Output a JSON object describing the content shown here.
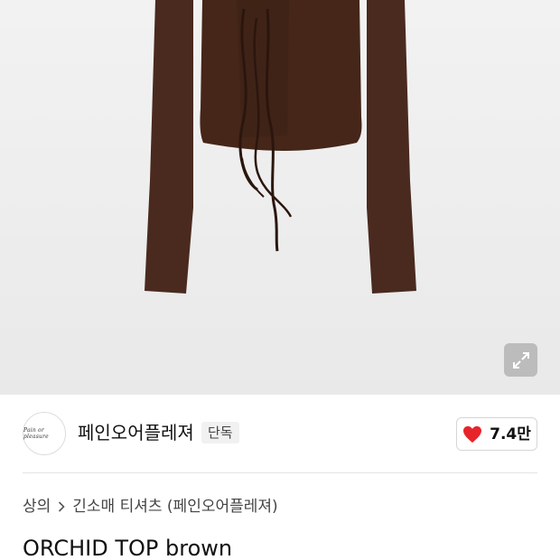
{
  "product_image": {
    "expand_icon": "expand-arrows-icon",
    "garment_color": "#4a2a1f"
  },
  "brand": {
    "logo_text": "Pain or pleasure",
    "name": "페인오어플레져",
    "badge": "단독"
  },
  "like": {
    "icon": "heart-icon",
    "count": "7.4만",
    "heart_color": "#e8242b"
  },
  "breadcrumb": {
    "category": "상의",
    "separator_icon": "chevron-right-icon",
    "subcategory": "긴소매 티셔츠 (페인오어플레져)"
  },
  "product": {
    "title": "ORCHID TOP brown"
  }
}
